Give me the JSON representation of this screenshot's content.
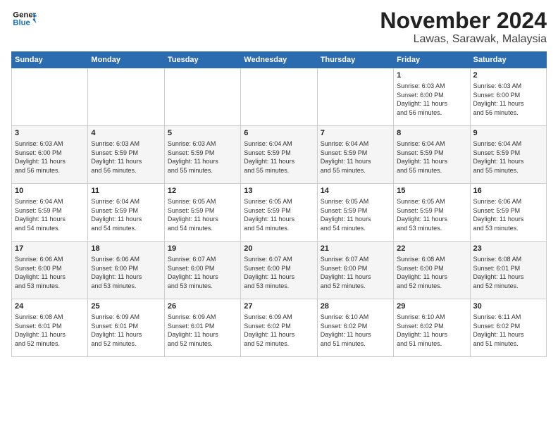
{
  "logo": {
    "line1": "General",
    "line2": "Blue"
  },
  "header": {
    "month": "November 2024",
    "location": "Lawas, Sarawak, Malaysia"
  },
  "weekdays": [
    "Sunday",
    "Monday",
    "Tuesday",
    "Wednesday",
    "Thursday",
    "Friday",
    "Saturday"
  ],
  "weeks": [
    [
      {
        "day": "",
        "info": ""
      },
      {
        "day": "",
        "info": ""
      },
      {
        "day": "",
        "info": ""
      },
      {
        "day": "",
        "info": ""
      },
      {
        "day": "",
        "info": ""
      },
      {
        "day": "1",
        "info": "Sunrise: 6:03 AM\nSunset: 6:00 PM\nDaylight: 11 hours\nand 56 minutes."
      },
      {
        "day": "2",
        "info": "Sunrise: 6:03 AM\nSunset: 6:00 PM\nDaylight: 11 hours\nand 56 minutes."
      }
    ],
    [
      {
        "day": "3",
        "info": "Sunrise: 6:03 AM\nSunset: 6:00 PM\nDaylight: 11 hours\nand 56 minutes."
      },
      {
        "day": "4",
        "info": "Sunrise: 6:03 AM\nSunset: 5:59 PM\nDaylight: 11 hours\nand 56 minutes."
      },
      {
        "day": "5",
        "info": "Sunrise: 6:03 AM\nSunset: 5:59 PM\nDaylight: 11 hours\nand 55 minutes."
      },
      {
        "day": "6",
        "info": "Sunrise: 6:04 AM\nSunset: 5:59 PM\nDaylight: 11 hours\nand 55 minutes."
      },
      {
        "day": "7",
        "info": "Sunrise: 6:04 AM\nSunset: 5:59 PM\nDaylight: 11 hours\nand 55 minutes."
      },
      {
        "day": "8",
        "info": "Sunrise: 6:04 AM\nSunset: 5:59 PM\nDaylight: 11 hours\nand 55 minutes."
      },
      {
        "day": "9",
        "info": "Sunrise: 6:04 AM\nSunset: 5:59 PM\nDaylight: 11 hours\nand 55 minutes."
      }
    ],
    [
      {
        "day": "10",
        "info": "Sunrise: 6:04 AM\nSunset: 5:59 PM\nDaylight: 11 hours\nand 54 minutes."
      },
      {
        "day": "11",
        "info": "Sunrise: 6:04 AM\nSunset: 5:59 PM\nDaylight: 11 hours\nand 54 minutes."
      },
      {
        "day": "12",
        "info": "Sunrise: 6:05 AM\nSunset: 5:59 PM\nDaylight: 11 hours\nand 54 minutes."
      },
      {
        "day": "13",
        "info": "Sunrise: 6:05 AM\nSunset: 5:59 PM\nDaylight: 11 hours\nand 54 minutes."
      },
      {
        "day": "14",
        "info": "Sunrise: 6:05 AM\nSunset: 5:59 PM\nDaylight: 11 hours\nand 54 minutes."
      },
      {
        "day": "15",
        "info": "Sunrise: 6:05 AM\nSunset: 5:59 PM\nDaylight: 11 hours\nand 53 minutes."
      },
      {
        "day": "16",
        "info": "Sunrise: 6:06 AM\nSunset: 5:59 PM\nDaylight: 11 hours\nand 53 minutes."
      }
    ],
    [
      {
        "day": "17",
        "info": "Sunrise: 6:06 AM\nSunset: 6:00 PM\nDaylight: 11 hours\nand 53 minutes."
      },
      {
        "day": "18",
        "info": "Sunrise: 6:06 AM\nSunset: 6:00 PM\nDaylight: 11 hours\nand 53 minutes."
      },
      {
        "day": "19",
        "info": "Sunrise: 6:07 AM\nSunset: 6:00 PM\nDaylight: 11 hours\nand 53 minutes."
      },
      {
        "day": "20",
        "info": "Sunrise: 6:07 AM\nSunset: 6:00 PM\nDaylight: 11 hours\nand 53 minutes."
      },
      {
        "day": "21",
        "info": "Sunrise: 6:07 AM\nSunset: 6:00 PM\nDaylight: 11 hours\nand 52 minutes."
      },
      {
        "day": "22",
        "info": "Sunrise: 6:08 AM\nSunset: 6:00 PM\nDaylight: 11 hours\nand 52 minutes."
      },
      {
        "day": "23",
        "info": "Sunrise: 6:08 AM\nSunset: 6:01 PM\nDaylight: 11 hours\nand 52 minutes."
      }
    ],
    [
      {
        "day": "24",
        "info": "Sunrise: 6:08 AM\nSunset: 6:01 PM\nDaylight: 11 hours\nand 52 minutes."
      },
      {
        "day": "25",
        "info": "Sunrise: 6:09 AM\nSunset: 6:01 PM\nDaylight: 11 hours\nand 52 minutes."
      },
      {
        "day": "26",
        "info": "Sunrise: 6:09 AM\nSunset: 6:01 PM\nDaylight: 11 hours\nand 52 minutes."
      },
      {
        "day": "27",
        "info": "Sunrise: 6:09 AM\nSunset: 6:02 PM\nDaylight: 11 hours\nand 52 minutes."
      },
      {
        "day": "28",
        "info": "Sunrise: 6:10 AM\nSunset: 6:02 PM\nDaylight: 11 hours\nand 51 minutes."
      },
      {
        "day": "29",
        "info": "Sunrise: 6:10 AM\nSunset: 6:02 PM\nDaylight: 11 hours\nand 51 minutes."
      },
      {
        "day": "30",
        "info": "Sunrise: 6:11 AM\nSunset: 6:02 PM\nDaylight: 11 hours\nand 51 minutes."
      }
    ]
  ]
}
